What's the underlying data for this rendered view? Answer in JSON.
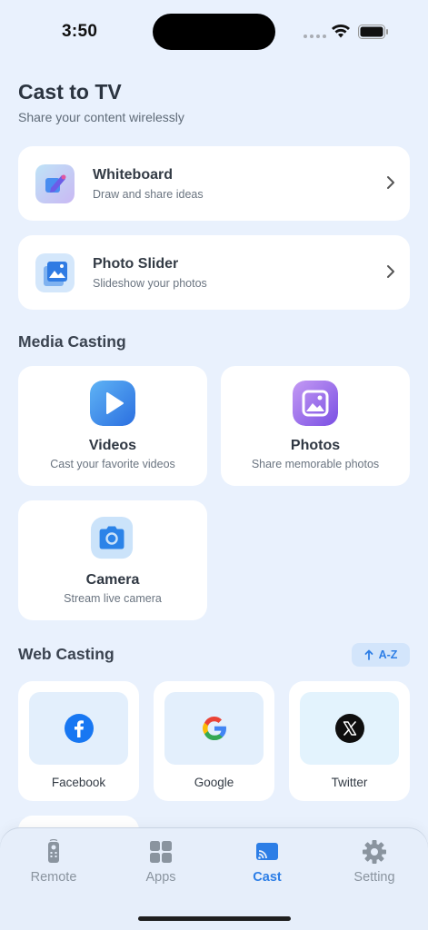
{
  "status": {
    "time": "3:50"
  },
  "header": {
    "title": "Cast to TV",
    "subtitle": "Share your content wirelessly"
  },
  "features": [
    {
      "title": "Whiteboard",
      "subtitle": "Draw and share ideas",
      "icon": "whiteboard-icon"
    },
    {
      "title": "Photo Slider",
      "subtitle": "Slideshow your photos",
      "icon": "photo-slider-icon"
    }
  ],
  "media_section": {
    "title": "Media Casting",
    "items": [
      {
        "title": "Videos",
        "subtitle": "Cast your favorite videos",
        "icon": "play-icon"
      },
      {
        "title": "Photos",
        "subtitle": "Share memorable photos",
        "icon": "image-icon"
      },
      {
        "title": "Camera",
        "subtitle": "Stream live camera",
        "icon": "camera-icon"
      }
    ]
  },
  "web_section": {
    "title": "Web Casting",
    "sort_label": "A-Z",
    "items": [
      {
        "label": "Facebook",
        "icon": "facebook-icon"
      },
      {
        "label": "Google",
        "icon": "google-icon"
      },
      {
        "label": "Twitter",
        "icon": "x-twitter-icon"
      }
    ]
  },
  "tabs": [
    {
      "label": "Remote",
      "icon": "remote-icon"
    },
    {
      "label": "Apps",
      "icon": "apps-grid-icon"
    },
    {
      "label": "Cast",
      "icon": "cast-icon",
      "active": true
    },
    {
      "label": "Setting",
      "icon": "gear-icon"
    }
  ],
  "colors": {
    "accent": "#2d7ee6",
    "background": "#e9f1fd",
    "card": "#ffffff"
  }
}
